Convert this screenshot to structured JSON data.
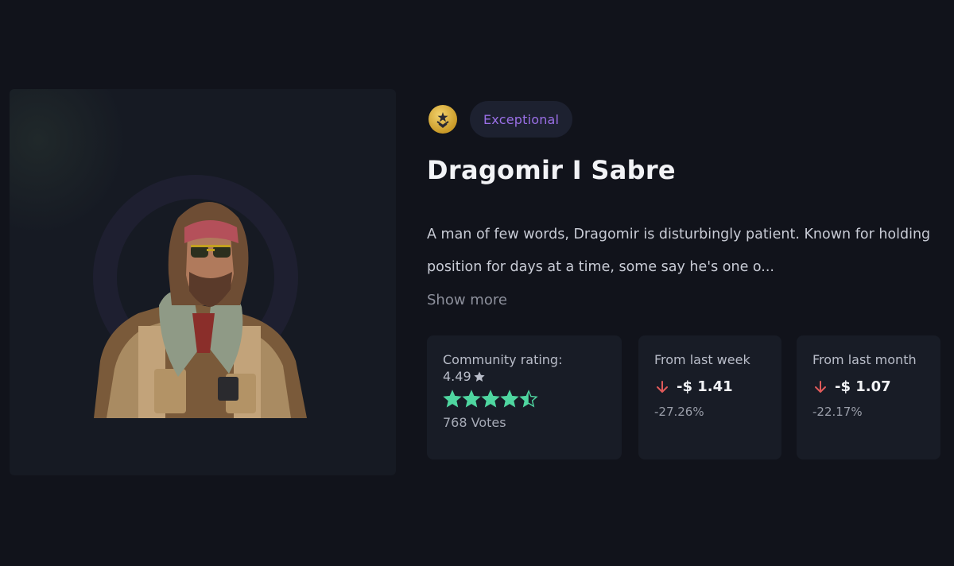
{
  "item": {
    "rarity": "Exceptional",
    "name": "Dragomir I Sabre",
    "description": "A man of few words, Dragomir is disturbingly patient. Known for holding position for days at a time, some say he's one o...",
    "show_more": "Show more"
  },
  "rating_card": {
    "label": "Community rating:",
    "value": "4.49",
    "stars_value": 4.49,
    "stars_max": 5,
    "votes": "768 Votes"
  },
  "week_card": {
    "label": "From last week",
    "change": "-$ 1.41",
    "percent": "-27.26%"
  },
  "month_card": {
    "label": "From last month",
    "change": "-$ 1.07",
    "percent": "-22.17%"
  },
  "colors": {
    "rarity": "#9a6fe6",
    "star": "#4fd6a0",
    "down_arrow": "#e05a5a"
  },
  "icons": {
    "rank": "rank-medal-icon",
    "rating_star": "star-icon",
    "down": "arrow-down-icon"
  }
}
